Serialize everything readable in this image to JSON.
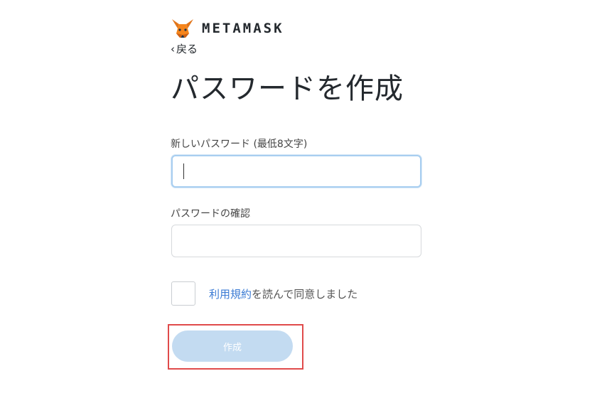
{
  "brand": {
    "name": "METAMASK",
    "logo_icon": "fox-icon"
  },
  "nav": {
    "back_label": "戻る"
  },
  "page": {
    "title": "パスワードを作成"
  },
  "form": {
    "new_password": {
      "label": "新しいパスワード (最低8文字)",
      "value": ""
    },
    "confirm_password": {
      "label": "パスワードの確認",
      "value": ""
    },
    "terms": {
      "checked": false,
      "link_text": "利用規約",
      "suffix_text": "を読んで同意しました"
    },
    "submit_label": "作成"
  },
  "colors": {
    "accent": "#3b7bd4",
    "button_disabled": "#c3dbf1",
    "highlight_box": "#e04b4b"
  }
}
